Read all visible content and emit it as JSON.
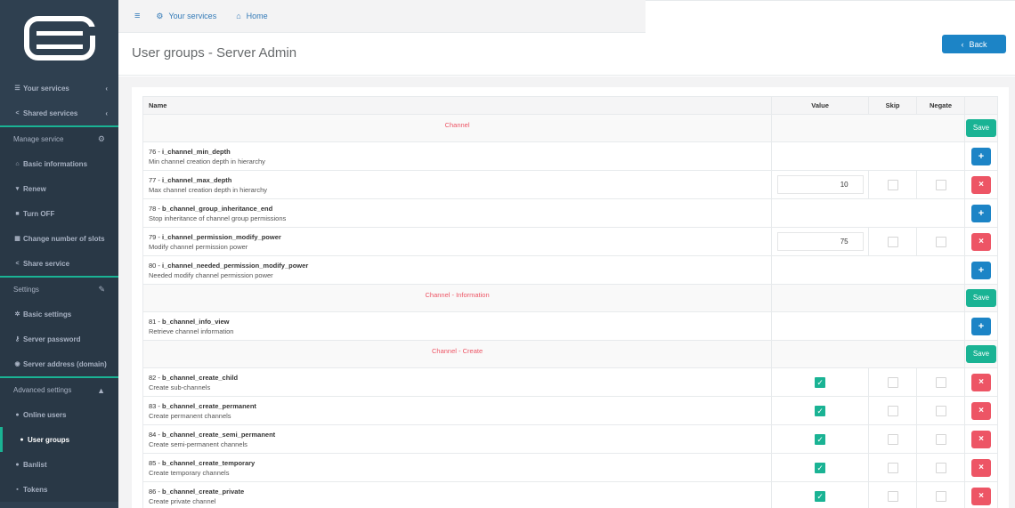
{
  "sidebar": {
    "items": [
      {
        "label": "Your services",
        "icon": "list-icon"
      },
      {
        "label": "Shared services",
        "icon": "share-icon"
      }
    ],
    "manage_section": "Manage service",
    "manage_items": [
      {
        "label": "Basic informations",
        "icon": "home-icon"
      },
      {
        "label": "Renew",
        "icon": "cart-icon"
      },
      {
        "label": "Turn OFF",
        "icon": "stop-icon"
      },
      {
        "label": "Change number of slots",
        "icon": "grid-icon"
      },
      {
        "label": "Share service",
        "icon": "share-icon"
      }
    ],
    "settings_section": "Settings",
    "settings_items": [
      {
        "label": "Basic settings",
        "icon": "gear-icon"
      },
      {
        "label": "Server password",
        "icon": "key-icon"
      },
      {
        "label": "Server address (domain)",
        "icon": "globe-icon"
      }
    ],
    "advanced_section": "Advanced settings",
    "advanced_items": [
      {
        "label": "Online users",
        "icon": "user-icon"
      },
      {
        "label": "User groups",
        "icon": "users-icon",
        "active": true
      },
      {
        "label": "Banlist",
        "icon": "ban-icon"
      },
      {
        "label": "Tokens",
        "icon": "lock-icon"
      }
    ]
  },
  "topbar": {
    "your_services": "Your services",
    "home": "Home"
  },
  "page": {
    "title": "User groups - Server Admin",
    "back_label": "Back"
  },
  "table": {
    "headers": {
      "name": "Name",
      "value": "Value",
      "skip": "Skip",
      "negate": "Negate"
    },
    "save_label": "Save",
    "groups": [
      {
        "title": "Channel"
      },
      {
        "title": "Channel - Information"
      },
      {
        "title": "Channel - Create"
      }
    ],
    "perms": [
      {
        "id": "76 - ",
        "key": "i_channel_min_depth",
        "desc": "Min channel creation depth in hierarchy",
        "value": "",
        "checked": false
      },
      {
        "id": "77 - ",
        "key": "i_channel_max_depth",
        "desc": "Max channel creation depth in hierarchy",
        "value": "10",
        "checked": false
      },
      {
        "id": "78 - ",
        "key": "b_channel_group_inheritance_end",
        "desc": "Stop inheritance of channel group permissions",
        "value": "",
        "checked": false
      },
      {
        "id": "79 - ",
        "key": "i_channel_permission_modify_power",
        "desc": "Modify channel permission power",
        "value": "75",
        "checked": false
      },
      {
        "id": "80 - ",
        "key": "i_channel_needed_permission_modify_power",
        "desc": "Needed modify channel permission power",
        "value": "",
        "checked": false
      },
      {
        "id": "81 - ",
        "key": "b_channel_info_view",
        "desc": "Retrieve channel information",
        "value": "",
        "checked": false
      },
      {
        "id": "82 - ",
        "key": "b_channel_create_child",
        "desc": "Create sub-channels",
        "value": "",
        "checked": true
      },
      {
        "id": "83 - ",
        "key": "b_channel_create_permanent",
        "desc": "Create permanent channels",
        "value": "",
        "checked": true
      },
      {
        "id": "84 - ",
        "key": "b_channel_create_semi_permanent",
        "desc": "Create semi-permanent channels",
        "value": "",
        "checked": true
      },
      {
        "id": "85 - ",
        "key": "b_channel_create_temporary",
        "desc": "Create temporary channels",
        "value": "",
        "checked": true
      },
      {
        "id": "86 - ",
        "key": "b_channel_create_private",
        "desc": "Create private channel",
        "value": "",
        "checked": true
      }
    ]
  },
  "colors": {
    "sidebar_bg": "#2f4050",
    "accent": "#1ab394",
    "primary": "#1c84c6",
    "danger": "#ed5565"
  }
}
